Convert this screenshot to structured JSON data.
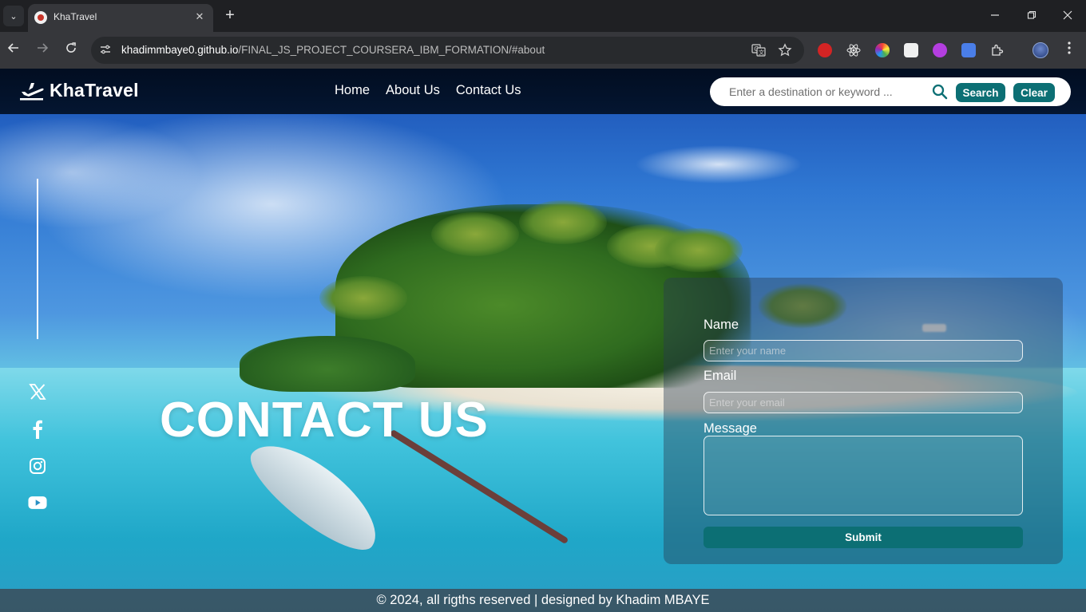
{
  "browser": {
    "tab_title": "KhaTravel",
    "tab_close_glyph": "✕",
    "new_tab_glyph": "+",
    "url_host": "khadimmbaye0.github.io",
    "url_path": "/FINAL_JS_PROJECT_COURSERA_IBM_FORMATION/#about",
    "icons": [
      "tab-search-icon",
      "site-favicon",
      "close-icon",
      "new-tab-icon",
      "minimize-icon",
      "maximize-icon",
      "window-close-icon",
      "back-icon",
      "forward-icon",
      "reload-icon",
      "site-info-icon",
      "translate-icon",
      "bookmark-star-icon",
      "extensions-icon",
      "profile-icon",
      "menu-icon"
    ]
  },
  "site": {
    "brand": "KhaTravel",
    "nav": [
      {
        "label": "Home"
      },
      {
        "label": "About Us"
      },
      {
        "label": "Contact Us"
      }
    ],
    "search": {
      "placeholder": "Enter a destination or keyword ...",
      "value": "",
      "search_label": "Search",
      "clear_label": "Clear"
    }
  },
  "hero": {
    "heading": "CONTACT US"
  },
  "social": [
    "x-icon",
    "facebook-icon",
    "instagram-icon",
    "youtube-icon"
  ],
  "form": {
    "name_label": "Name",
    "name_placeholder": "Enter your name",
    "email_label": "Email",
    "email_placeholder": "Enter your email",
    "message_label": "Message",
    "submit_label": "Submit"
  },
  "footer": {
    "text": "© 2024, all rigths reserved | designed by Khadim MBAYE"
  },
  "colors": {
    "accent": "#0c6f74",
    "header_bg": "#00101e",
    "chrome_bg": "#1f2023"
  }
}
